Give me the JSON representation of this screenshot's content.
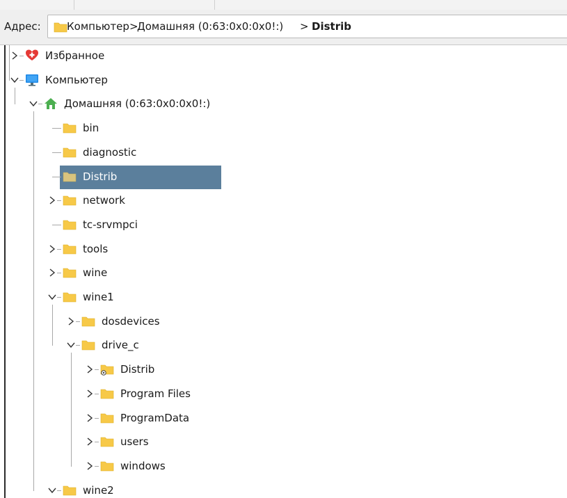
{
  "address_bar": {
    "label": "Адрес:",
    "breadcrumbs": [
      {
        "label": "Компьютер"
      },
      {
        "label": "Домашняя (0:63:0x0:0x0!:)"
      },
      {
        "label": "Distrib",
        "current": true
      }
    ],
    "separator": ">"
  },
  "tree": {
    "items": [
      {
        "label": "Избранное",
        "icon": "favorites-heart-icon",
        "expander": "collapsed"
      },
      {
        "label": "Компьютер",
        "icon": "computer-monitor-icon",
        "expander": "expanded"
      },
      {
        "label": "Домашняя (0:63:0x0:0x0!:)",
        "icon": "home-icon",
        "expander": "expanded"
      },
      {
        "label": "bin",
        "icon": "folder-icon",
        "expander": "none"
      },
      {
        "label": "diagnostic",
        "icon": "folder-icon",
        "expander": "none"
      },
      {
        "label": "Distrib",
        "icon": "folder-icon",
        "expander": "none",
        "selected": true
      },
      {
        "label": "network",
        "icon": "folder-icon",
        "expander": "collapsed"
      },
      {
        "label": "tc-srvmpci",
        "icon": "folder-icon",
        "expander": "none"
      },
      {
        "label": "tools",
        "icon": "folder-icon",
        "expander": "collapsed"
      },
      {
        "label": "wine",
        "icon": "folder-icon",
        "expander": "collapsed"
      },
      {
        "label": "wine1",
        "icon": "folder-icon",
        "expander": "expanded"
      },
      {
        "label": "dosdevices",
        "icon": "folder-icon",
        "expander": "collapsed"
      },
      {
        "label": "drive_c",
        "icon": "folder-icon",
        "expander": "expanded"
      },
      {
        "label": "Distrib",
        "icon": "folder-link-icon",
        "expander": "collapsed"
      },
      {
        "label": "Program Files",
        "icon": "folder-icon",
        "expander": "collapsed"
      },
      {
        "label": "ProgramData",
        "icon": "folder-icon",
        "expander": "collapsed"
      },
      {
        "label": "users",
        "icon": "folder-icon",
        "expander": "collapsed"
      },
      {
        "label": "windows",
        "icon": "folder-icon",
        "expander": "collapsed"
      },
      {
        "label": "wine2",
        "icon": "folder-icon",
        "expander": "expanded"
      }
    ]
  },
  "colors": {
    "selection": "#5b7f9c",
    "folder": "#f7c948",
    "folder_selected": "#d9c47e",
    "favorites_heart": "#e53935",
    "computer_monitor": "#1e88e5",
    "home": "#4caf50"
  }
}
